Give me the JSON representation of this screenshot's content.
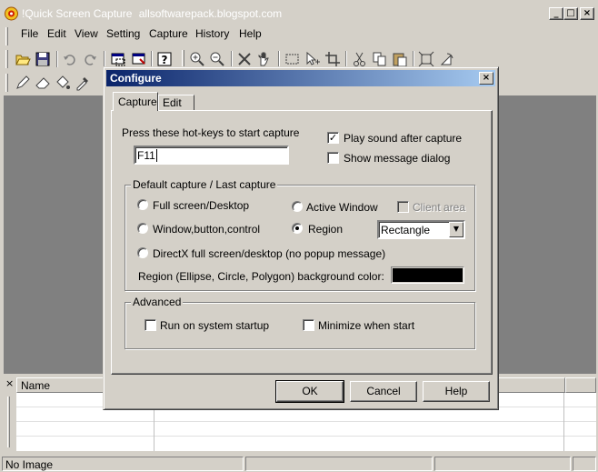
{
  "app": {
    "title": "!Quick Screen Capture",
    "subtitle": "allsoftwarepack.blogspot.com"
  },
  "menu": [
    "File",
    "Edit",
    "View",
    "Setting",
    "Capture",
    "History",
    "Help"
  ],
  "list": {
    "column_name": "Name"
  },
  "statusbar": {
    "text": "No Image"
  },
  "dialog": {
    "title": "Configure",
    "tabs": [
      "Capture",
      "Edit"
    ],
    "active_tab": "Capture",
    "hotkey_label": "Press these hot-keys to start capture",
    "hotkey_value": "F11",
    "play_sound": {
      "label": "Play sound after capture",
      "checked": true
    },
    "show_message": {
      "label": "Show message dialog",
      "checked": false
    },
    "capture_group": {
      "label": "Default capture / Last capture",
      "full_screen": "Full screen/Desktop",
      "active_window": "Active Window",
      "client_area": "Client area",
      "window_control": "Window,button,control",
      "region": "Region",
      "region_shape": "Rectangle",
      "directx": "DirectX full screen/desktop (no popup message)",
      "bg_color_label": "Region (Ellipse, Circle, Polygon) background color:",
      "bg_color": "#000000",
      "selected": "Region"
    },
    "advanced_group": {
      "label": "Advanced",
      "run_startup": "Run on system startup",
      "minimize_start": "Minimize when start"
    },
    "buttons": {
      "ok": "OK",
      "cancel": "Cancel",
      "help": "Help"
    }
  },
  "colors": {
    "face": "#d4d0c8",
    "workspace": "#808080",
    "title_gradient_start": "#0a246a",
    "title_gradient_end": "#a6caf0"
  }
}
